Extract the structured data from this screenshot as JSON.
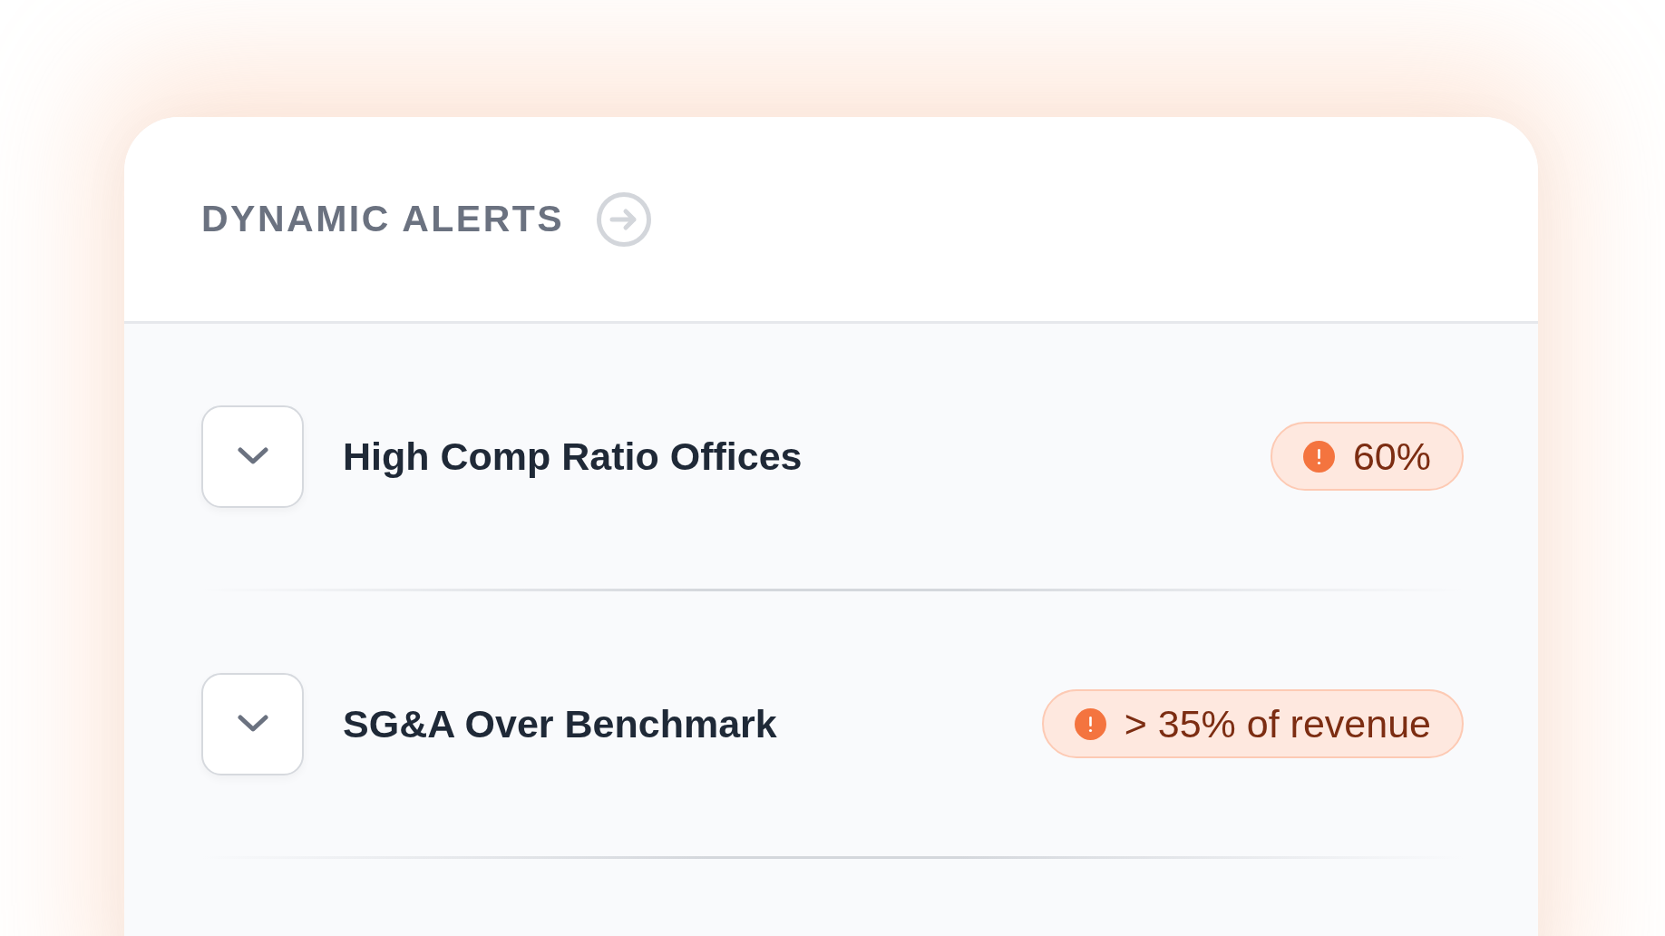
{
  "header": {
    "title": "DYNAMIC ALERTS"
  },
  "alerts": [
    {
      "title": "High Comp Ratio Offices",
      "expanded": false,
      "badge": "60%"
    },
    {
      "title": "SG&A Over Benchmark",
      "expanded": false,
      "badge": "> 35% of revenue"
    }
  ]
}
